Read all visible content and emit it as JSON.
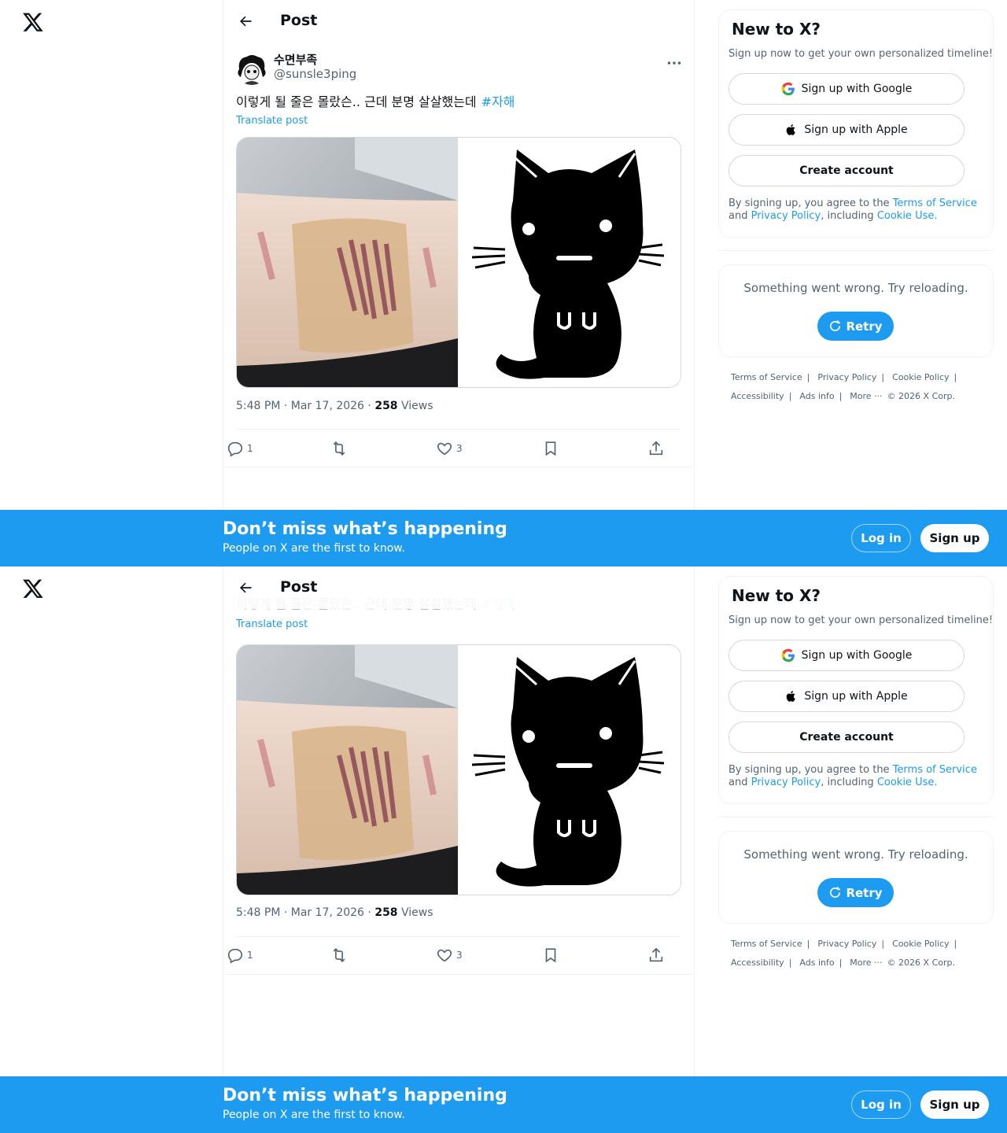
{
  "header": {
    "title": "Post"
  },
  "post": {
    "author_name": "수면부족",
    "author_handle": "@sunsle3ping",
    "text": "이렇게 될 줄은 몰랐슨.. 근데 분명 살살했는데",
    "hashtag": "#자해",
    "translate": "Translate post",
    "time": "5:48 PM · Mar 17, 2026 · ",
    "views_count": "258",
    "views_label": " Views",
    "replies": "1",
    "retweets": "",
    "likes": "3",
    "media": [
      {
        "icon": "photo-arm"
      },
      {
        "icon": "black-cat-drawing"
      }
    ]
  },
  "sidebar": {
    "new_title": "New to X?",
    "new_sub": "Sign up now to get your own personalized timeline!",
    "google": "Sign up with Google",
    "apple": "Sign up with Apple",
    "create": "Create account",
    "legal_pre": "By signing up, you agree to the ",
    "terms": "Terms of Service",
    "legal_and": " and ",
    "privacy": "Privacy Policy",
    "legal_incl": ", including ",
    "cookie": "Cookie Use.",
    "error": "Something went wrong. Try reloading.",
    "retry": "Retry"
  },
  "footer": {
    "terms": "Terms of Service",
    "privacy": "Privacy Policy",
    "cookie": "Cookie Policy",
    "accessibility": "Accessibility",
    "ads": "Ads info",
    "more": "More ···",
    "copyright": "© 2026 X Corp."
  },
  "banner": {
    "title": "Don’t miss what’s happening",
    "sub": "People on X are the first to know.",
    "login": "Log in",
    "signup": "Sign up"
  },
  "colors": {
    "accent": "#1d9bf0",
    "text": "#0f1419",
    "muted": "#536471",
    "border": "#eff3f4"
  }
}
